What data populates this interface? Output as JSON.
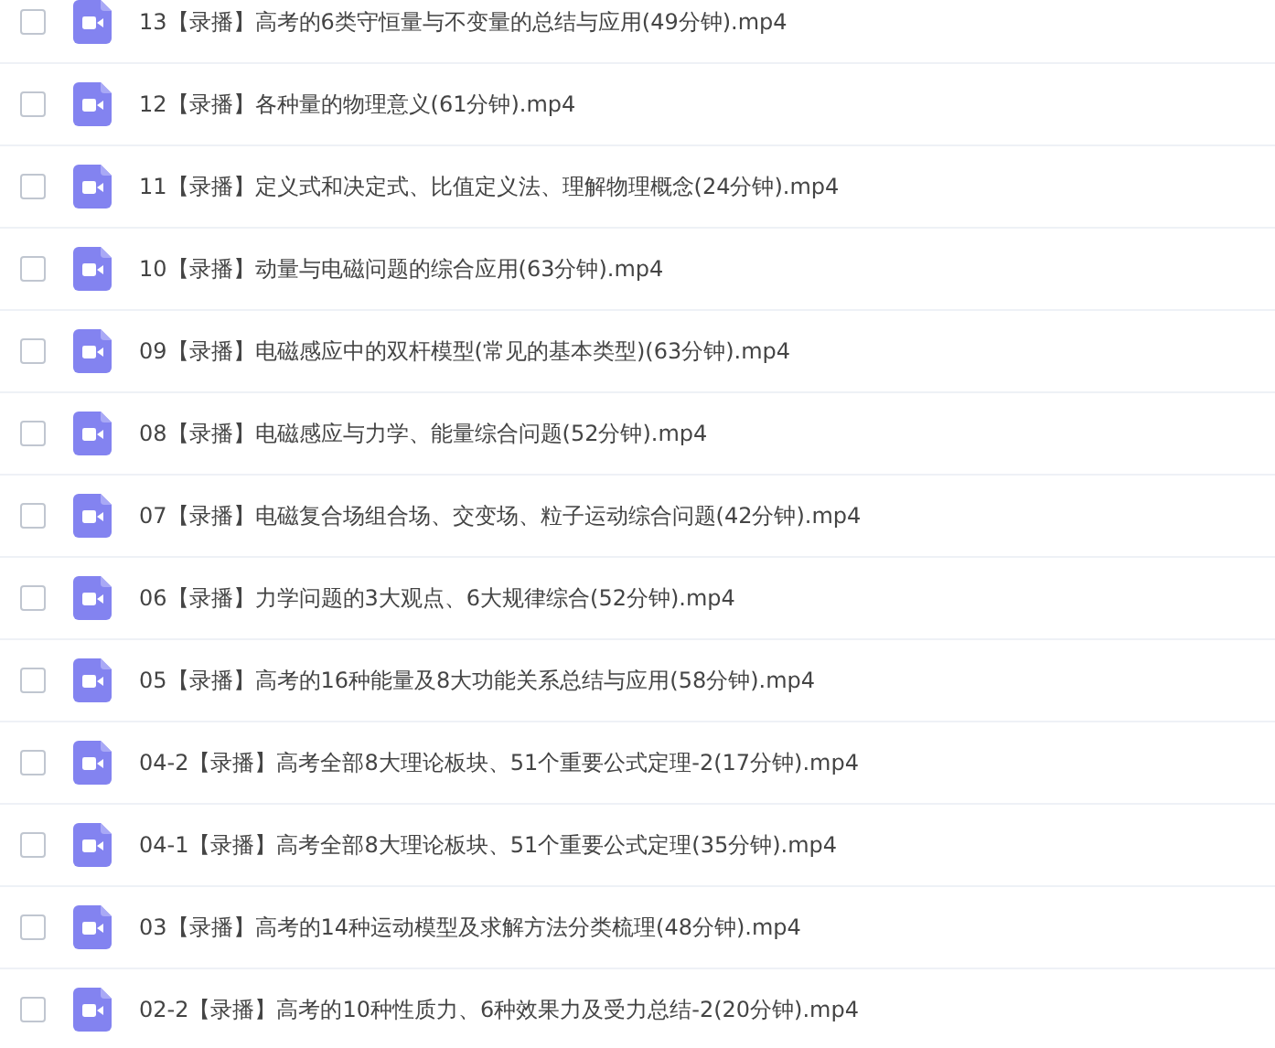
{
  "files": [
    {
      "name": "13【录播】高考的6类守恒量与不变量的总结与应用(49分钟).mp4",
      "checked": false
    },
    {
      "name": "12【录播】各种量的物理意义(61分钟).mp4",
      "checked": false
    },
    {
      "name": "11【录播】定义式和决定式、比值定义法、理解物理概念(24分钟).mp4",
      "checked": false
    },
    {
      "name": "10【录播】动量与电磁问题的综合应用(63分钟).mp4",
      "checked": false
    },
    {
      "name": "09【录播】电磁感应中的双杆模型(常见的基本类型)(63分钟).mp4",
      "checked": false
    },
    {
      "name": "08【录播】电磁感应与力学、能量综合问题(52分钟).mp4",
      "checked": false
    },
    {
      "name": "07【录播】电磁复合场组合场、交变场、粒子运动综合问题(42分钟).mp4",
      "checked": false
    },
    {
      "name": "06【录播】力学问题的3大观点、6大规律综合(52分钟).mp4",
      "checked": false
    },
    {
      "name": "05【录播】高考的16种能量及8大功能关系总结与应用(58分钟).mp4",
      "checked": false
    },
    {
      "name": "04-2【录播】高考全部8大理论板块、51个重要公式定理-2(17分钟).mp4",
      "checked": false
    },
    {
      "name": "04-1【录播】高考全部8大理论板块、51个重要公式定理(35分钟).mp4",
      "checked": false
    },
    {
      "name": "03【录播】高考的14种运动模型及求解方法分类梳理(48分钟).mp4",
      "checked": false
    },
    {
      "name": "02-2【录播】高考的10种性质力、6种效果力及受力总结-2(20分钟).mp4",
      "checked": false
    }
  ]
}
